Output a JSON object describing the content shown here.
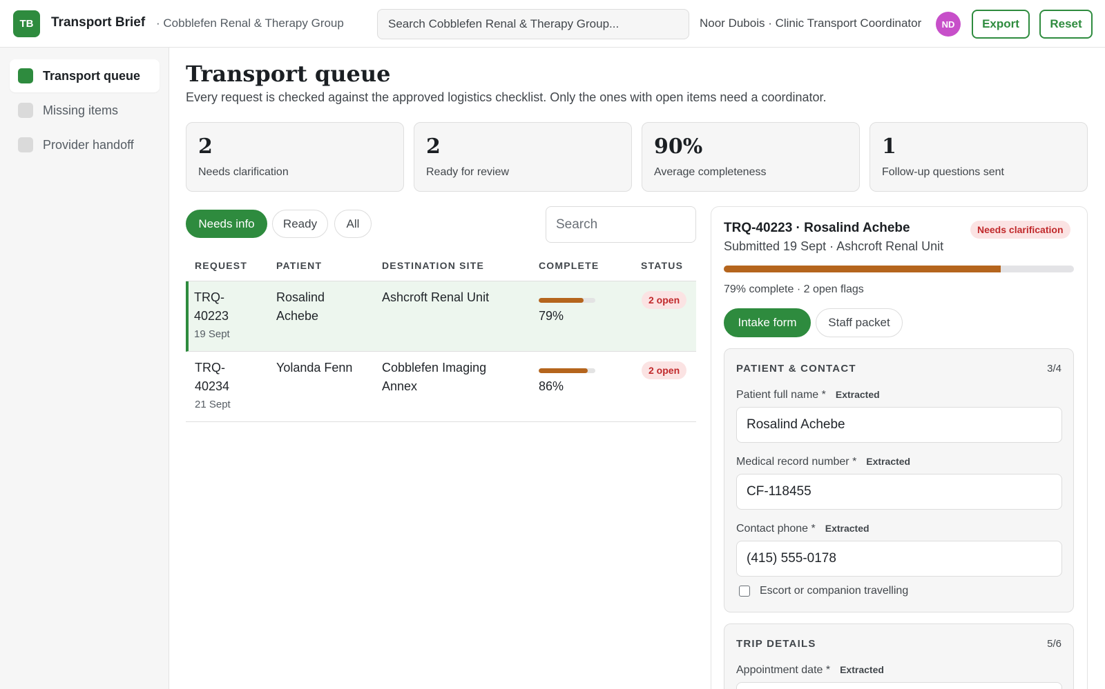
{
  "header": {
    "logo_text": "TB",
    "app_name": "Transport Brief",
    "org": "· Cobblefen Renal & Therapy Group",
    "search_placeholder": "Search Cobblefen Renal & Therapy Group...",
    "user": "Noor Dubois · Clinic Transport Coordinator",
    "avatar": "ND",
    "export_label": "Export",
    "reset_label": "Reset"
  },
  "sidebar": {
    "items": [
      {
        "label": "Transport queue",
        "active": true
      },
      {
        "label": "Missing items",
        "active": false
      },
      {
        "label": "Provider handoff",
        "active": false
      }
    ]
  },
  "main": {
    "title": "Transport queue",
    "subtitle": "Every request is checked against the approved logistics checklist. Only the ones with open items need a coordinator.",
    "stats": [
      {
        "value": "2",
        "label": "Needs clarification"
      },
      {
        "value": "2",
        "label": "Ready for review"
      },
      {
        "value": "90%",
        "label": "Average completeness"
      },
      {
        "value": "1",
        "label": "Follow-up questions sent"
      }
    ],
    "filters": [
      "Needs info",
      "Ready",
      "All"
    ],
    "active_filter": "Needs info",
    "search_placeholder": "Search",
    "columns": [
      "REQUEST",
      "PATIENT",
      "DESTINATION SITE",
      "COMPLETE",
      "STATUS"
    ],
    "rows": [
      {
        "request_line1": "TRQ-",
        "request_line2": "40223",
        "date": "19 Sept",
        "patient_line1": "Rosalind",
        "patient_line2": "Achebe",
        "site_line1": "Ashcroft Renal Unit",
        "site_line2": "",
        "complete": "79%",
        "complete_fraction": 0.79,
        "status": "2 open",
        "selected": true
      },
      {
        "request_line1": "TRQ-",
        "request_line2": "40234",
        "date": "21 Sept",
        "patient_line1": "Yolanda Fenn",
        "patient_line2": "",
        "site_line1": "Cobblefen Imaging",
        "site_line2": "Annex",
        "complete": "86%",
        "complete_fraction": 0.86,
        "status": "2 open",
        "selected": false
      }
    ]
  },
  "detail": {
    "title": "TRQ-40223 · Rosalind Achebe",
    "badge": "Needs clarification",
    "submitted": "Submitted 19 Sept · Ashcroft Renal Unit",
    "progress_fraction": 0.79,
    "progress_text": "79% complete · 2 open flags",
    "tabs": [
      "Intake form",
      "Staff packet"
    ],
    "active_tab": "Intake form",
    "sections": [
      {
        "heading": "PATIENT & CONTACT",
        "count": "3/4",
        "fields": [
          {
            "label": "Patient full name *",
            "tag": "Extracted",
            "value": "Rosalind Achebe"
          },
          {
            "label": "Medical record number *",
            "tag": "Extracted",
            "value": "CF-118455"
          },
          {
            "label": "Contact phone *",
            "tag": "Extracted",
            "value": "(415) 555-0178"
          }
        ],
        "checkbox": {
          "label": "Escort or companion travelling",
          "checked": false
        }
      },
      {
        "heading": "TRIP DETAILS",
        "count": "5/6",
        "fields": [
          {
            "label": "Appointment date *",
            "tag": "Extracted",
            "value": ""
          }
        ]
      }
    ]
  },
  "colors": {
    "brand_green": "#2e8b3e",
    "progress_amber": "#b5651d",
    "alert_red": "#c0292b",
    "alert_red_bg": "#fbe3e3",
    "avatar_purple": "#c74fc9"
  }
}
